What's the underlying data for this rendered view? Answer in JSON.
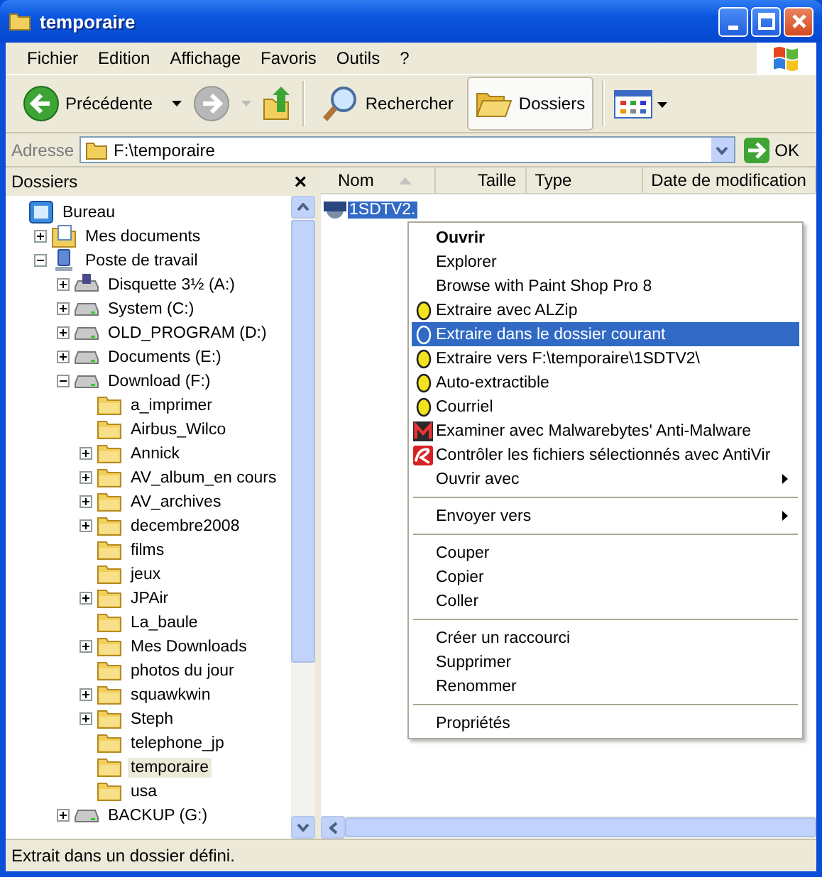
{
  "window": {
    "title": "temporaire"
  },
  "menu_bar": [
    "Fichier",
    "Edition",
    "Affichage",
    "Favoris",
    "Outils",
    "?"
  ],
  "toolbar": {
    "back": "Précédente",
    "search": "Rechercher",
    "folders": {
      "label": "Dossiers",
      "selected": true
    }
  },
  "address_bar": {
    "label": "Adresse",
    "value": "F:\\temporaire",
    "go": "OK"
  },
  "folders_pane": {
    "title": "Dossiers",
    "close": "×",
    "tree": [
      {
        "label": "Bureau",
        "kind": "desktop",
        "selected": false,
        "children": [
          {
            "label": "Mes documents",
            "kind": "documents",
            "expanded": false,
            "selected": false
          },
          {
            "label": "Poste de travail",
            "kind": "computer",
            "expanded": true,
            "selected": false,
            "children": [
              {
                "label": "Disquette 3½ (A:)",
                "kind": "floppy",
                "expanded": false,
                "selected": false
              },
              {
                "label": "System (C:)",
                "kind": "drive",
                "expanded": false,
                "selected": false
              },
              {
                "label": "OLD_PROGRAM (D:)",
                "kind": "drive",
                "expanded": false,
                "selected": false
              },
              {
                "label": "Documents (E:)",
                "kind": "drive",
                "expanded": false,
                "selected": false
              },
              {
                "label": "Download (F:)",
                "kind": "drive",
                "expanded": true,
                "selected": false,
                "children": [
                  {
                    "label": "a_imprimer",
                    "kind": "folder",
                    "selected": false
                  },
                  {
                    "label": "Airbus_Wilco",
                    "kind": "folder",
                    "selected": false
                  },
                  {
                    "label": "Annick",
                    "kind": "folder",
                    "expanded": false,
                    "selected": false
                  },
                  {
                    "label": "AV_album_en cours",
                    "kind": "folder",
                    "expanded": false,
                    "selected": false
                  },
                  {
                    "label": "AV_archives",
                    "kind": "folder",
                    "expanded": false,
                    "selected": false
                  },
                  {
                    "label": "decembre2008",
                    "kind": "folder",
                    "expanded": false,
                    "selected": false
                  },
                  {
                    "label": "films",
                    "kind": "folder",
                    "selected": false
                  },
                  {
                    "label": "jeux",
                    "kind": "folder",
                    "selected": false
                  },
                  {
                    "label": "JPAir",
                    "kind": "folder",
                    "expanded": false,
                    "selected": false
                  },
                  {
                    "label": "La_baule",
                    "kind": "folder",
                    "selected": false
                  },
                  {
                    "label": "Mes Downloads",
                    "kind": "folder",
                    "expanded": false,
                    "selected": false
                  },
                  {
                    "label": "photos du jour",
                    "kind": "folder",
                    "selected": false
                  },
                  {
                    "label": "squawkwin",
                    "kind": "folder",
                    "expanded": false,
                    "selected": false
                  },
                  {
                    "label": "Steph",
                    "kind": "folder",
                    "expanded": false,
                    "selected": false
                  },
                  {
                    "label": "telephone_jp",
                    "kind": "folder",
                    "selected": false
                  },
                  {
                    "label": "temporaire",
                    "kind": "folder",
                    "selected": true
                  },
                  {
                    "label": "usa",
                    "kind": "folder",
                    "selected": false
                  }
                ]
              },
              {
                "label": "BACKUP (G:)",
                "kind": "drive",
                "expanded": false,
                "selected": false
              }
            ]
          }
        ]
      }
    ]
  },
  "file_list": {
    "columns": [
      {
        "label": "Nom",
        "sorted": true
      },
      {
        "label": "Taille",
        "sorted": false
      },
      {
        "label": "Type",
        "sorted": false
      },
      {
        "label": "Date de modification",
        "sorted": false
      }
    ],
    "rows": [
      {
        "name": "1SDTV2.",
        "selected": true
      }
    ]
  },
  "context_menu": [
    {
      "kind": "plain",
      "label": "Ouvrir",
      "bold": true,
      "selected": false,
      "submenu": false
    },
    {
      "kind": "plain",
      "label": "Explorer",
      "bold": false,
      "selected": false,
      "submenu": false
    },
    {
      "kind": "plain",
      "label": "Browse with Paint Shop Pro 8",
      "bold": false,
      "selected": false,
      "submenu": false
    },
    {
      "kind": "extract",
      "label": "Extraire avec ALZip",
      "bold": false,
      "selected": false,
      "submenu": false
    },
    {
      "kind": "extract",
      "label": "Extraire dans le dossier courant",
      "bold": false,
      "selected": true,
      "submenu": false
    },
    {
      "kind": "extract",
      "label": "Extraire vers F:\\temporaire\\1SDTV2\\",
      "bold": false,
      "selected": false,
      "submenu": false
    },
    {
      "kind": "extract",
      "label": "Auto-extractible",
      "bold": false,
      "selected": false,
      "submenu": false
    },
    {
      "kind": "extract",
      "label": "Courriel",
      "bold": false,
      "selected": false,
      "submenu": false
    },
    {
      "kind": "scan",
      "label": "Examiner avec Malwarebytes' Anti-Malware",
      "bold": false,
      "selected": false,
      "submenu": false
    },
    {
      "kind": "antivir",
      "label": "Contrôler les fichiers sélectionnés avec AntiVir",
      "bold": false,
      "selected": false,
      "submenu": false
    },
    {
      "kind": "plain",
      "label": "Ouvrir avec",
      "bold": false,
      "selected": false,
      "submenu": true
    },
    {
      "kind": "separator"
    },
    {
      "kind": "plain",
      "label": "Envoyer vers",
      "bold": false,
      "selected": false,
      "submenu": true
    },
    {
      "kind": "separator"
    },
    {
      "kind": "plain",
      "label": "Couper",
      "bold": false,
      "selected": false,
      "submenu": false
    },
    {
      "kind": "plain",
      "label": "Copier",
      "bold": false,
      "selected": false,
      "submenu": false
    },
    {
      "kind": "plain",
      "label": "Coller",
      "bold": false,
      "selected": false,
      "submenu": false
    },
    {
      "kind": "separator"
    },
    {
      "kind": "plain",
      "label": "Créer un raccourci",
      "bold": false,
      "selected": false,
      "submenu": false
    },
    {
      "kind": "plain",
      "label": "Supprimer",
      "bold": false,
      "selected": false,
      "submenu": false
    },
    {
      "kind": "plain",
      "label": "Renommer",
      "bold": false,
      "selected": false,
      "submenu": false
    },
    {
      "kind": "separator"
    },
    {
      "kind": "plain",
      "label": "Propriétés",
      "bold": false,
      "selected": false,
      "submenu": false
    }
  ],
  "status_bar": "Extrait dans un dossier défini."
}
